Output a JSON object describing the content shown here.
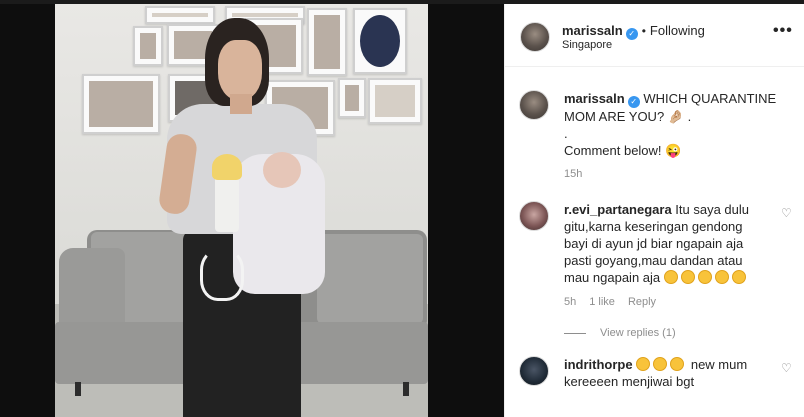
{
  "post": {
    "author": {
      "username": "marissaln",
      "verified_icon": "verified-badge-icon",
      "following_label": "Following",
      "separator": "•",
      "location": "Singapore"
    },
    "more_label": "•••",
    "caption": {
      "username": "marissaln",
      "line1": "WHICH QUARANTINE",
      "line2": "MOM ARE YOU? 🤌🏼 .",
      "line3": ".",
      "line4": "Comment below! 😜",
      "timestamp": "15h"
    }
  },
  "comments": [
    {
      "username": "r.evi_partanegara",
      "text_line1": " Itu saya dulu",
      "text_line2": "gitu,karna keseringan gendong",
      "text_line3": "bayi di ayun jd biar ngapain aja",
      "text_line4": "pasti goyang,mau dandan atau",
      "text_line5": "mau ngapain aja",
      "emoji_count": 5,
      "time": "5h",
      "likes": "1 like",
      "reply_label": "Reply",
      "view_replies_label": "View replies (1)"
    },
    {
      "username": "indrithorpe",
      "text_line1": " new mum",
      "text_line2": "kereeeen menjiwai bgt",
      "emoji_count": 3
    }
  ],
  "colors": {
    "link_blue": "#3897f0",
    "muted_gray": "#8e8e8e",
    "text": "#262626"
  }
}
